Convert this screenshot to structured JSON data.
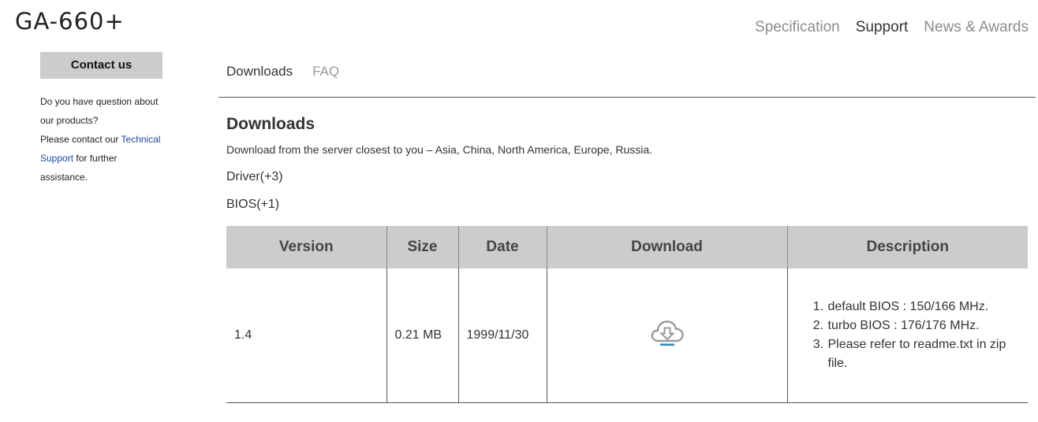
{
  "header": {
    "title": "GA-660+"
  },
  "nav": {
    "items": [
      "Specification",
      "Support",
      "News & Awards"
    ]
  },
  "sidebar": {
    "contact_label": "Contact us",
    "line1": "Do you have question about",
    "line2": "our products?",
    "line3_prefix": "Please contact our ",
    "link1": "Technical",
    "link2": "Support",
    "line4_suffix": " for further assistance."
  },
  "tabs": [
    "Downloads",
    "FAQ"
  ],
  "downloads": {
    "title": "Downloads",
    "description": "Download from the server closest to you – Asia, China, North America, Europe, Russia.",
    "categories": [
      "Driver(+3)",
      "BIOS(+1)"
    ]
  },
  "table": {
    "headers": [
      "Version",
      "Size",
      "Date",
      "Download",
      "Description"
    ],
    "row": {
      "version": "1.4",
      "size": "0.21 MB",
      "date": "1999/11/30",
      "download_icon": "cloud-download-icon",
      "description": [
        "default BIOS : 150/166 MHz.",
        "turbo BIOS : 176/176 MHz.",
        "Please refer to readme.txt in zip file."
      ]
    }
  },
  "colors": {
    "link": "#1a47b4",
    "header_bg": "#cccccc",
    "icon_accent": "#1a8fd6"
  }
}
